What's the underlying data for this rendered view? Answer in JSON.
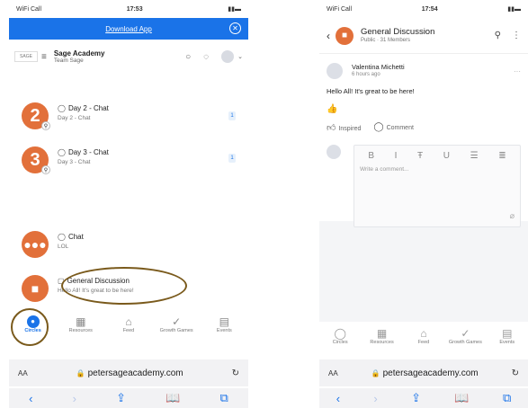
{
  "left": {
    "status": {
      "carrier": "WiFi Call",
      "time": "17:53"
    },
    "banner": {
      "label": "Download App",
      "close": "✕"
    },
    "header": {
      "logo": "SAGE",
      "org_name": "Sage Academy",
      "team": "Team Sage"
    },
    "items": [
      {
        "badge": "2",
        "title": "Day 2 - Chat",
        "subtitle": "Day 2 - Chat",
        "count": "1"
      },
      {
        "badge": "3",
        "title": "Day 3 - Chat",
        "subtitle": "Day 3 - Chat",
        "count": "1"
      },
      {
        "badge": "",
        "title": "Chat",
        "subtitle": "LOL",
        "count": ""
      },
      {
        "badge": "",
        "title": "General Discussion",
        "subtitle": "Hello All! It's great to be here!",
        "count": ""
      }
    ],
    "tabs": [
      {
        "label": "Circles",
        "icon": "chat-bubble-icon"
      },
      {
        "label": "Resources",
        "icon": "grid-icon"
      },
      {
        "label": "Feed",
        "icon": "home-icon"
      },
      {
        "label": "Growth Games",
        "icon": "check-circle-icon"
      },
      {
        "label": "Events",
        "icon": "calendar-icon"
      }
    ],
    "browser": {
      "text_size": "AA",
      "url": "petersageacademy.com"
    }
  },
  "right": {
    "status": {
      "carrier": "WiFi Call",
      "time": "17:54"
    },
    "header": {
      "title": "General Discussion",
      "meta": "Public · 31 Members"
    },
    "post": {
      "author": "Valentina Michetti",
      "time_ago": "6 hours ago",
      "body": "Hello All! It's great to be here!",
      "reaction": "👍",
      "inspired_label": "Inspired",
      "comment_label": "Comment"
    },
    "composer": {
      "placeholder": "Write a comment..."
    },
    "tabs": [
      {
        "label": "Circles"
      },
      {
        "label": "Resources"
      },
      {
        "label": "Feed"
      },
      {
        "label": "Growth Games"
      },
      {
        "label": "Events"
      }
    ],
    "browser": {
      "text_size": "AA",
      "url": "petersageacademy.com"
    }
  },
  "colors": {
    "accent": "#1a73e8",
    "badge": "#e2703a",
    "annotation": "#7a5a1c"
  }
}
